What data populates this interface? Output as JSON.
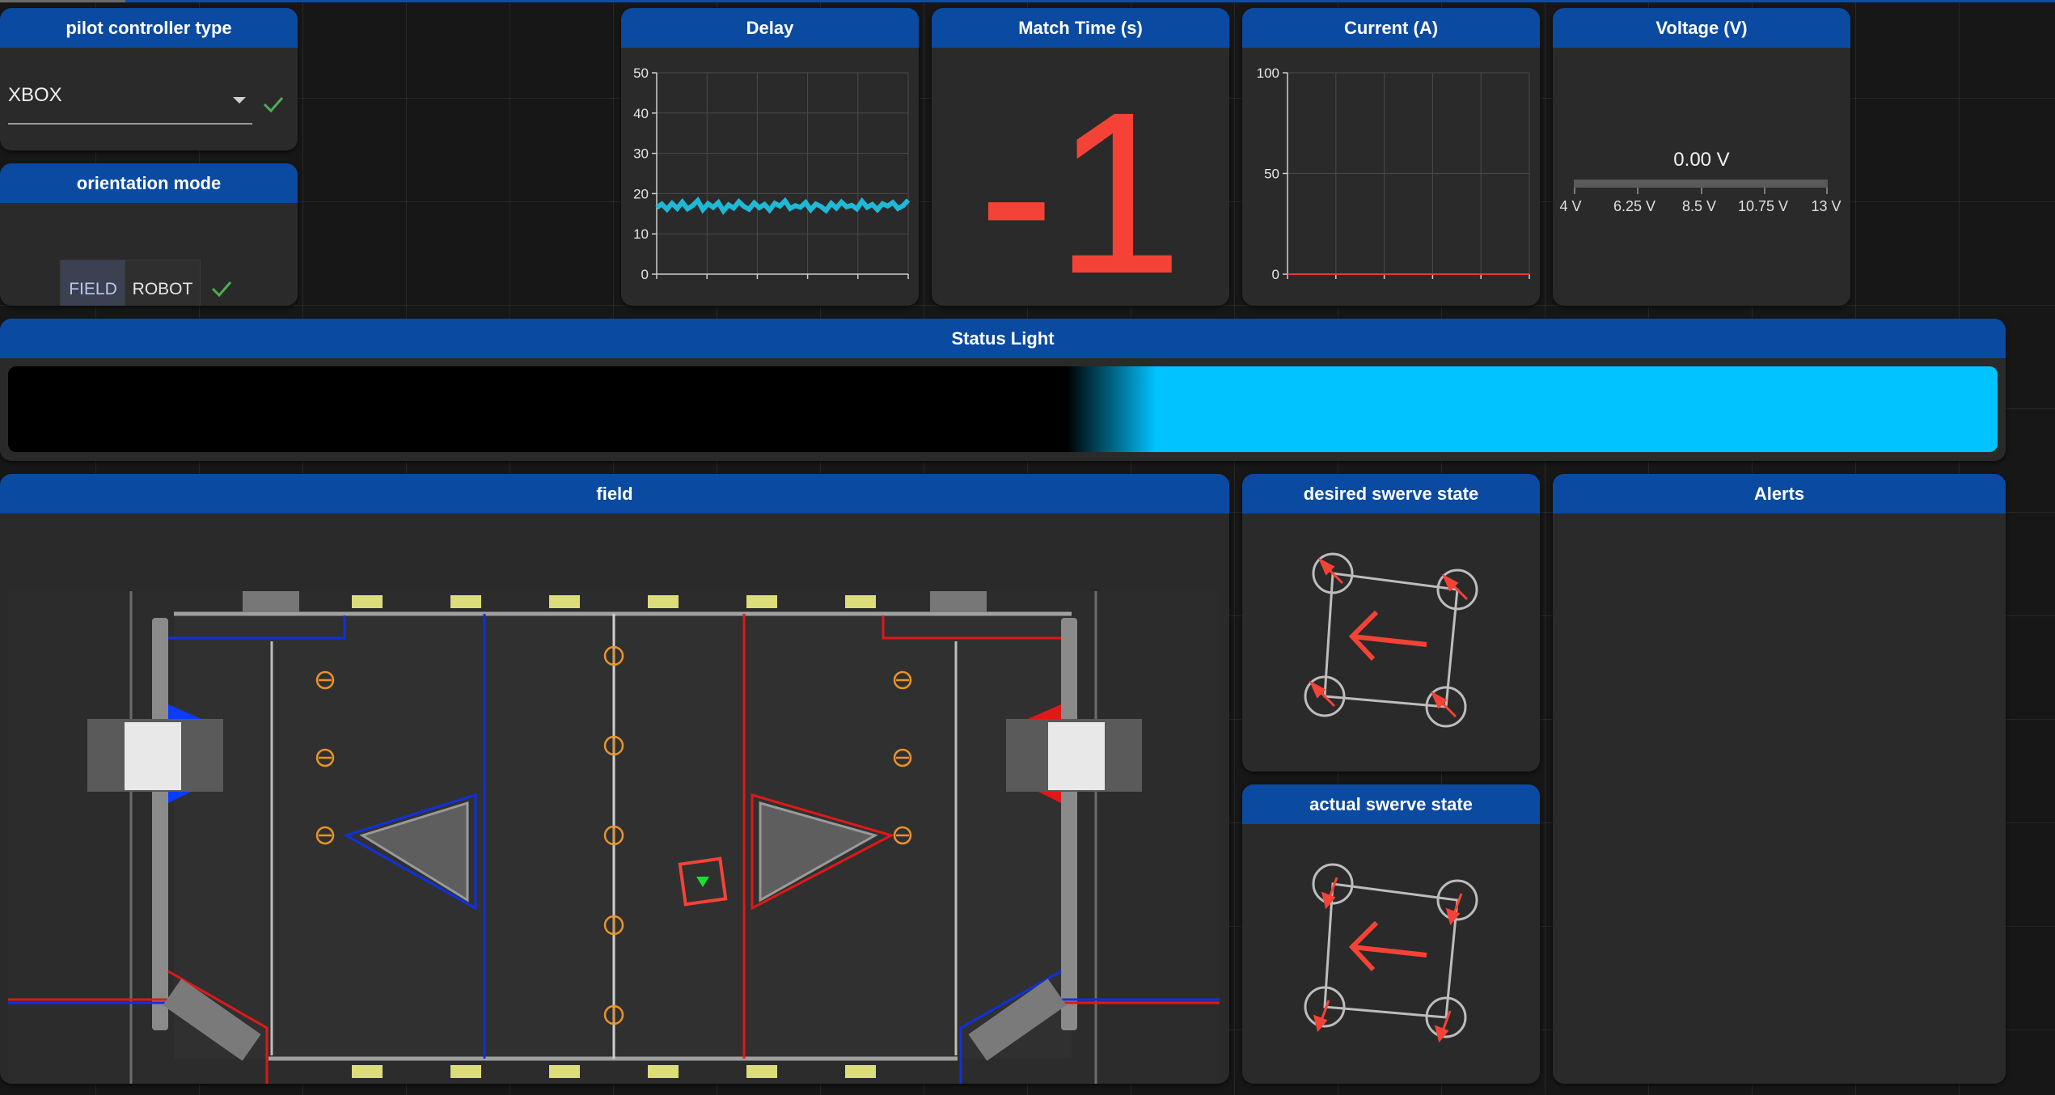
{
  "pilot_controller": {
    "title": "pilot controller type",
    "value": "XBOX"
  },
  "orientation": {
    "title": "orientation mode",
    "options": [
      "FIELD",
      "ROBOT"
    ],
    "selected": "FIELD"
  },
  "delay": {
    "title": "Delay",
    "chart_data": {
      "type": "line",
      "y_ticks": [
        "50",
        "40",
        "30",
        "20",
        "10",
        "0"
      ],
      "ylim": [
        0,
        50
      ],
      "grid": true,
      "series": [
        {
          "color": "#1fb8d6",
          "values": [
            16.5,
            17.4,
            16.1,
            17.6,
            16.3,
            17.9,
            16.2,
            17.0,
            18.3,
            16.0,
            17.5,
            16.6,
            17.8,
            15.7,
            17.2,
            16.4,
            18.0,
            16.8,
            16.1,
            17.7,
            16.5,
            17.3,
            15.9,
            17.6,
            16.9,
            18.2,
            16.3,
            17.0,
            16.6,
            17.8,
            16.0,
            17.4,
            16.8,
            15.8,
            17.6,
            16.4,
            17.9,
            16.7,
            17.1,
            16.2,
            18.1,
            16.6,
            17.3,
            16.0,
            17.5,
            16.9,
            17.8,
            16.3,
            17.0,
            18.4
          ]
        }
      ]
    }
  },
  "match_time": {
    "title": "Match Time (s)",
    "value": "-1"
  },
  "current": {
    "title": "Current (A)",
    "chart_data": {
      "type": "line",
      "y_ticks": [
        "100",
        "50",
        "0"
      ],
      "ylim": [
        0,
        100
      ],
      "grid": true,
      "series": [
        {
          "color": "#e53935",
          "values": [
            0,
            0,
            0,
            0,
            0,
            0,
            0,
            0,
            0,
            0
          ]
        }
      ]
    }
  },
  "voltage": {
    "title": "Voltage (V)",
    "value_label": "0.00 V",
    "value": 0,
    "range": [
      4,
      13
    ],
    "ticks": [
      "4 V",
      "6.25 V",
      "8.5 V",
      "10.75 V",
      "13 V"
    ]
  },
  "status_light": {
    "title": "Status Light",
    "color": "#00c3ff",
    "fill_fraction": 0.55
  },
  "field": {
    "title": "field",
    "robot_color": "#f44336",
    "robot_marker_color": "#19e02d",
    "blue_alliance": "#0a3cff",
    "red_alliance": "#e01818",
    "marker_color": "#e8942a"
  },
  "desired_swerve": {
    "title": "desired swerve state",
    "module_angles_deg": [
      225,
      225,
      225,
      225
    ],
    "heading_deg": 180
  },
  "actual_swerve": {
    "title": "actual swerve state",
    "module_angles_deg": [
      250,
      250,
      250,
      250
    ],
    "heading_deg": 180
  },
  "alerts": {
    "title": "Alerts",
    "items": []
  }
}
